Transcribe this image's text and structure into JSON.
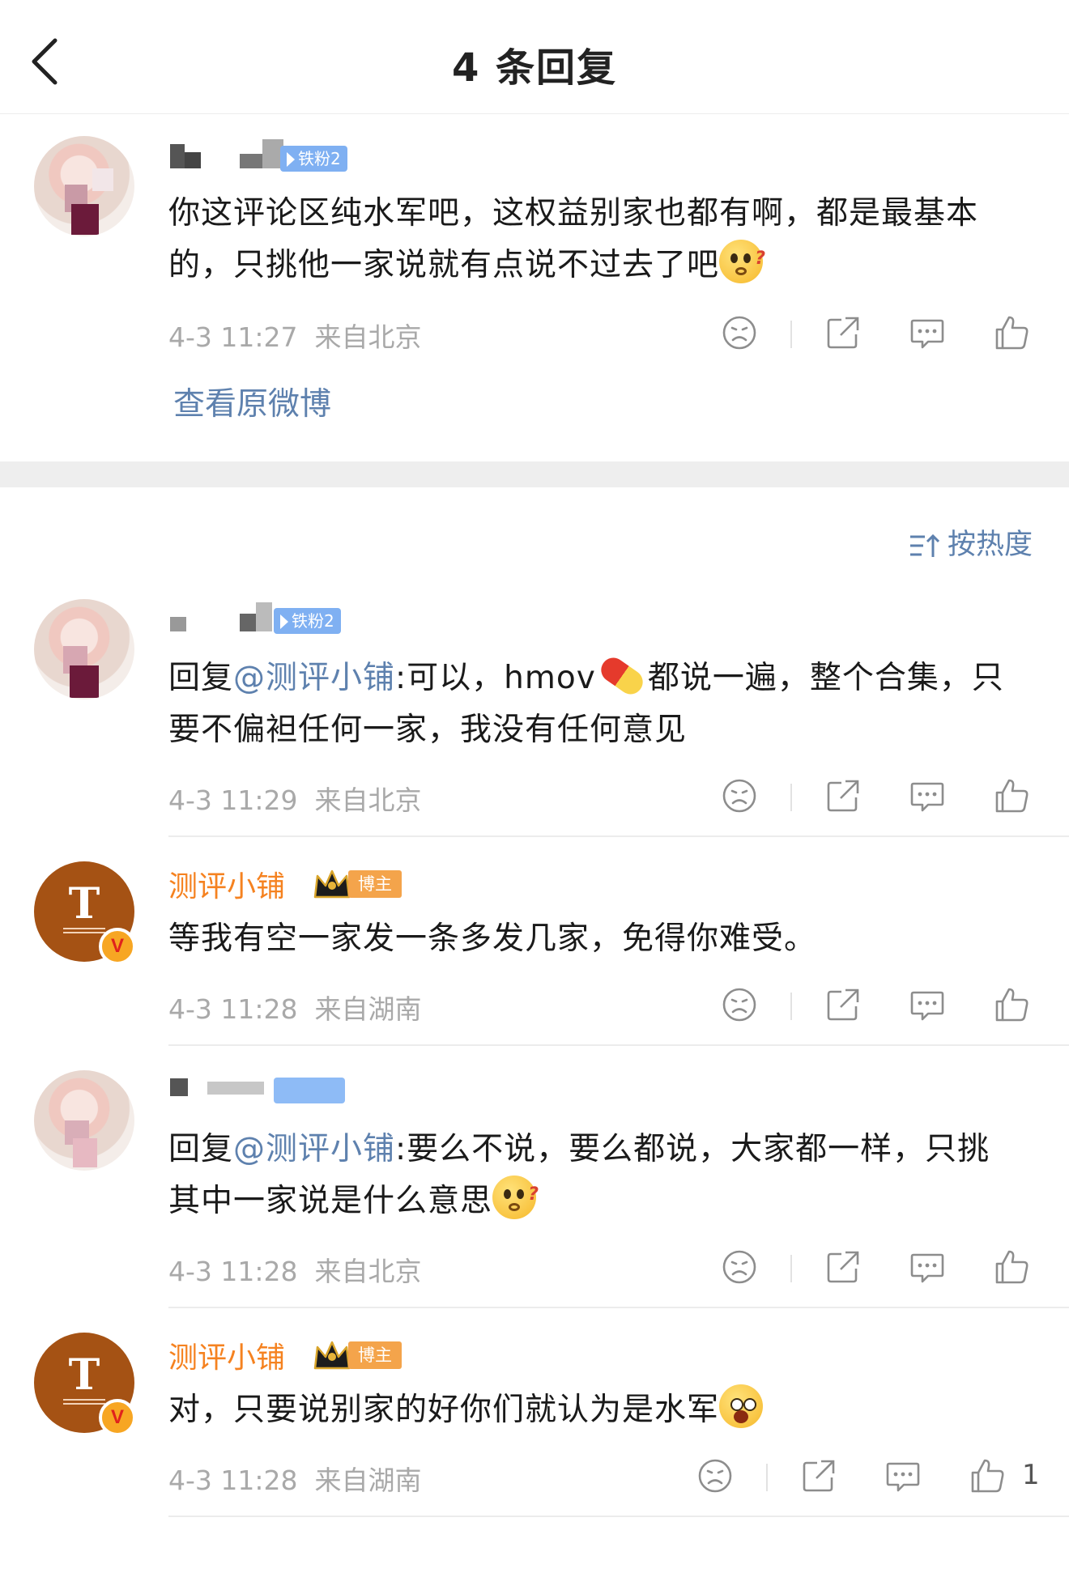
{
  "header": {
    "title": "4 条回复",
    "back_icon": "chevron-left-icon"
  },
  "main_comment": {
    "fan_badge": "铁粉2",
    "text": "你这评论区纯水军吧，这权益别家也都有啊，都是最基本的，只挑他一家说就有点说不过去了吧",
    "emoji": "thinking-emoji",
    "time": "4-3 11:27",
    "location": "来自北京",
    "view_original": "查看原微博"
  },
  "sort": {
    "label": "按热度",
    "icon": "sort-icon"
  },
  "replies": [
    {
      "fan_badge": "铁粉2",
      "reply_prefix": "回复",
      "mention": "@测评小铺",
      "text_before_pill": ":可以，hmov",
      "text_after_pill": "都说一遍，整个合集，只要不偏袒任何一家，我没有任何意见",
      "time": "4-3 11:29",
      "location": "来自北京"
    },
    {
      "username": "测评小铺",
      "blogger_badge": "博主",
      "avatar_letter": "T",
      "verified_mark": "V",
      "text": "等我有空一家发一条多发几家，免得你难受。",
      "time": "4-3 11:28",
      "location": "来自湖南"
    },
    {
      "reply_prefix": "回复",
      "mention": "@测评小铺",
      "text": ":要么不说，要么都说，大家都一样，只挑其中一家说是什么意思",
      "emoji": "thinking-emoji",
      "time": "4-3 11:28",
      "location": "来自北京"
    },
    {
      "username": "测评小铺",
      "blogger_badge": "博主",
      "avatar_letter": "T",
      "verified_mark": "V",
      "text": "对，只要说别家的好你们就认为是水军",
      "emoji": "screaming-emoji",
      "time": "4-3 11:28",
      "location": "来自湖南",
      "like_count": "1"
    }
  ],
  "colors": {
    "link": "#5e81ae",
    "brand_name": "#f58220",
    "fan_badge": "#7fb0f2",
    "meta": "#a9a9a9"
  }
}
